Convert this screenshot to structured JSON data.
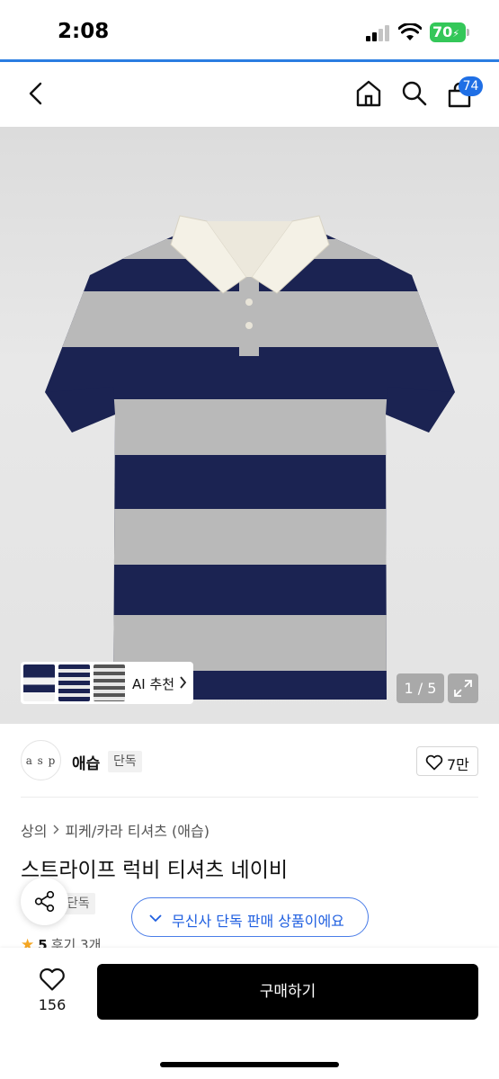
{
  "status_bar": {
    "time": "2:08",
    "battery": "70"
  },
  "nav": {
    "cart_count": "74",
    "icons": [
      "back-icon",
      "home-icon",
      "search-icon",
      "cart-icon"
    ]
  },
  "gallery": {
    "ai_label": "AI 추천",
    "counter": "1 / 5",
    "colors": {
      "navy": "#1b2352",
      "grey": "#b9b9b9",
      "collar": "#f4f1e6"
    }
  },
  "brand": {
    "name": "애습",
    "tag": "단독",
    "like_count": "7만"
  },
  "breadcrumb": {
    "category": "상의",
    "subcategory": "피케/카라 티셔츠 (애습)"
  },
  "product": {
    "title": "스트라이프 럭비 티셔츠 네이비",
    "partial_tag": "단독",
    "rating": "5",
    "review_text": "후기 3개"
  },
  "toast": {
    "text": "무신사 단독 판매 상품이에요"
  },
  "bottom": {
    "wish_count": "156",
    "buy_label": "구매하기"
  },
  "accent": "#1f6fe5"
}
